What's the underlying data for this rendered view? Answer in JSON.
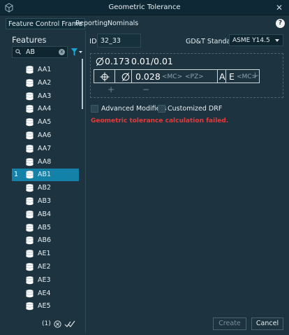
{
  "window": {
    "title": "Geometric Tolerance",
    "close_glyph": "✕"
  },
  "tabs": [
    {
      "label": "Feature Control Frame",
      "active": true
    },
    {
      "label": "Reporting",
      "active": false
    },
    {
      "label": "Nominals",
      "active": false
    }
  ],
  "help_glyph": "?",
  "features": {
    "heading": "Features",
    "search_value": "AB",
    "clear_glyph": "x",
    "items": [
      {
        "label": "AA1",
        "num": ""
      },
      {
        "label": "AA2",
        "num": ""
      },
      {
        "label": "AA3",
        "num": ""
      },
      {
        "label": "AA4",
        "num": ""
      },
      {
        "label": "AA5",
        "num": ""
      },
      {
        "label": "AA6",
        "num": ""
      },
      {
        "label": "AA7",
        "num": ""
      },
      {
        "label": "AA8",
        "num": ""
      },
      {
        "label": "AB1",
        "num": "1",
        "selected": true
      },
      {
        "label": "AB2",
        "num": ""
      },
      {
        "label": "AB3",
        "num": ""
      },
      {
        "label": "AB4",
        "num": ""
      },
      {
        "label": "AB5",
        "num": ""
      },
      {
        "label": "AB6",
        "num": ""
      },
      {
        "label": "AE1",
        "num": ""
      },
      {
        "label": "AE2",
        "num": ""
      },
      {
        "label": "AE3",
        "num": ""
      },
      {
        "label": "AE4",
        "num": ""
      },
      {
        "label": "AE5",
        "num": ""
      }
    ],
    "selection_count": "(1)"
  },
  "form": {
    "id_label": "ID",
    "id_value": "32_33",
    "standard_label": "GD&T Standard",
    "standard_value": "ASME Y14.5"
  },
  "fcf": {
    "top_value": "0.173",
    "top_range": "0.01/0.01",
    "tolerance_value": "0.028",
    "modifier_mc": "<MC>",
    "modifier_pz": "<PZ>",
    "datum_a": "A",
    "datum_e": "E",
    "datum_modifier": "<MC>",
    "add_glyph": "+",
    "remove_glyph": "−"
  },
  "options": {
    "advanced_modifiers": "Advanced Modifiers",
    "customized_drf": "Customized DRF"
  },
  "error_message": "Geometric tolerance calculation failed.",
  "buttons": {
    "create": "Create",
    "cancel": "Cancel"
  },
  "colors": {
    "accent": "#1381a8",
    "error": "#e23a3a",
    "background": "#1d3440"
  }
}
